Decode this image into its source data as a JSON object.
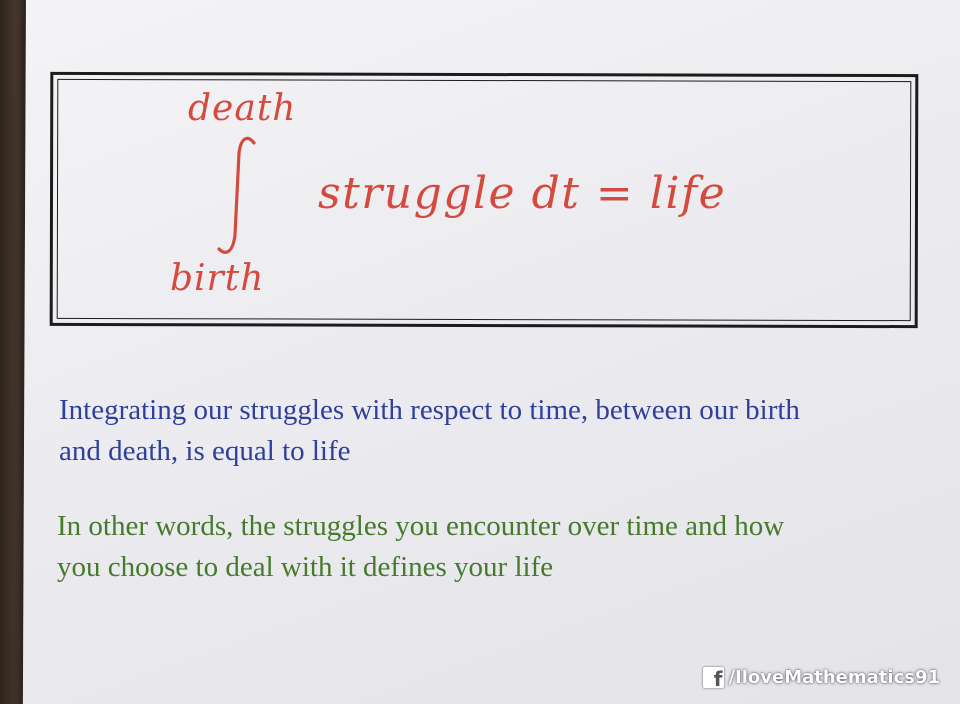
{
  "formula": {
    "upper_limit": "death",
    "lower_limit": "birth",
    "integrand": "struggle  dt = life"
  },
  "meaning": {
    "line1": "Integrating our struggles with respect to time, between our birth",
    "line2": "and death, is equal to life"
  },
  "interpretation": {
    "line1": "In other words, the struggles you encounter over time and how",
    "line2": "you choose to deal with it defines your life"
  },
  "watermark": {
    "icon": "facebook-icon",
    "icon_glyph": "f",
    "text": "/IloveMathematics91"
  },
  "colors": {
    "formula": "#d44a3e",
    "meaning": "#2f3f9c",
    "interpretation": "#467a2c",
    "frame": "#1c1c1c"
  }
}
